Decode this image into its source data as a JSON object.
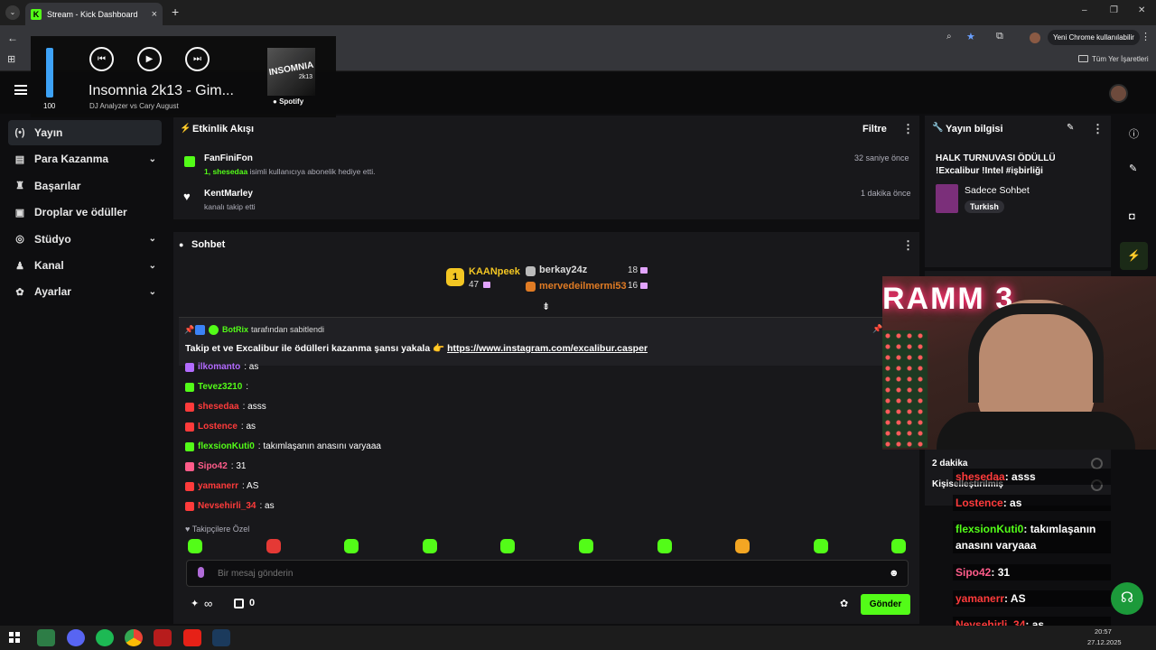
{
  "browser": {
    "tab_title": "Stream - Kick Dashboard",
    "tab_close": "×",
    "new_tab": "+",
    "profile_label": "Yeni Chrome kullanılabilir",
    "bookmarks_label": "Tüm Yer İşaretleri",
    "window_buttons": [
      "–",
      "❐",
      "✕"
    ]
  },
  "media_player": {
    "volume": "100",
    "volume_level": 1.0,
    "track_title": "Insomnia 2k13 - Gim...",
    "track_artist": "DJ Analyzer vs Cary August",
    "album_art_text": "INSOMNIA",
    "album_art_sub": "2k13",
    "service": "Spotify"
  },
  "sidebar": {
    "items": [
      {
        "label": "Yayın",
        "icon": "broadcast-icon",
        "glyph": "(•)",
        "active": true,
        "expand": false
      },
      {
        "label": "Para Kazanma",
        "icon": "money-icon",
        "glyph": "▤",
        "active": false,
        "expand": true
      },
      {
        "label": "Başarılar",
        "icon": "trophy-icon",
        "glyph": "♜",
        "active": false,
        "expand": false
      },
      {
        "label": "Droplar ve ödüller",
        "icon": "gift-icon",
        "glyph": "▣",
        "active": false,
        "expand": false
      },
      {
        "label": "Stüdyo",
        "icon": "studio-icon",
        "glyph": "◎",
        "active": false,
        "expand": true
      },
      {
        "label": "Kanal",
        "icon": "people-icon",
        "glyph": "♟",
        "active": false,
        "expand": true
      },
      {
        "label": "Ayarlar",
        "icon": "gear-icon",
        "glyph": "✿",
        "active": false,
        "expand": true
      }
    ]
  },
  "activity": {
    "title": "Etkinlik Akışı",
    "filter": "Filtre",
    "events": [
      {
        "user": "FanFiniFon",
        "detail_prefix": "1, shesedaa",
        "detail": " isimli kullanıcıya abonelik hediye etti.",
        "time": "32 saniye önce"
      },
      {
        "user": "KentMarley",
        "detail_prefix": "",
        "detail": "kanalı takip etti",
        "time": "1 dakika önce"
      }
    ]
  },
  "chat": {
    "title": "Sohbet",
    "leaderboard": [
      {
        "rank": "1",
        "name": "KAANpeek",
        "count": "47"
      },
      {
        "rank": "",
        "name": "berkay24z",
        "count": "18"
      },
      {
        "rank": "",
        "name": "mervedeilmermi53",
        "count": "16"
      }
    ],
    "pinned_by": "BotRix",
    "pinned_suffix": "tarafından sabitlendi",
    "pinned_text": "Takip et ve Excalibur ile ödülleri kazanma şansı yakala 👉 ",
    "pinned_link": "https://www.instagram.com/excalibur.casper",
    "messages": [
      {
        "user": "ilkomanto",
        "text": ": as",
        "color": "#b36bff"
      },
      {
        "user": "Tevez3210",
        "text": ":",
        "color": "#53fc18"
      },
      {
        "user": "shesedaa",
        "text": ": asss",
        "color": "#ff3b3b"
      },
      {
        "user": "Lostence",
        "text": ": as",
        "color": "#ff3b3b"
      },
      {
        "user": "flexsionKuti0",
        "text": ": takımlaşanın anasını varyaaa",
        "color": "#53fc18"
      },
      {
        "user": "Sipo42",
        "text": ": 31",
        "color": "#ff5c8a"
      },
      {
        "user": "yamanerr",
        "text": ": AS",
        "color": "#ff3b3b"
      },
      {
        "user": "Nevsehirli_34",
        "text": ": as",
        "color": "#ff3b3b"
      }
    ],
    "followers_only": "Takipçilere Özel",
    "input_placeholder": "Bir mesaj gönderin",
    "points": "∞",
    "chest_count": "0",
    "send": "Gönder"
  },
  "stream_info": {
    "title": "Yayın bilgisi",
    "stream_title": "HALK TURNUVASI ÖDÜLLÜ !Excalibur !Intel #işbirliği",
    "category": "Sadece Sohbet",
    "tag": "Turkish",
    "duration": "2 dakika",
    "customized": "Kişiselleştirilmiş"
  },
  "overlay_chat": [
    {
      "user": "shesedaa",
      "text": ": asss",
      "color": "#ff3b3b"
    },
    {
      "user": "Lostence",
      "text": ": as",
      "color": "#ff3b3b"
    },
    {
      "user": "flexsionKuti0",
      "text": ": takımlaşanın anasını varyaaa",
      "color": "#53fc18"
    },
    {
      "user": "Sipo42",
      "text": ": 31",
      "color": "#ff5c8a"
    },
    {
      "user": "yamanerr",
      "text": ": AS",
      "color": "#ff3b3b"
    },
    {
      "user": "Nevsehirli_34",
      "text": ": as",
      "color": "#ff3b3b"
    }
  ],
  "taskbar": {
    "time": "20:57",
    "date": "27.12.2025"
  },
  "colors": {
    "accent": "#53fc18",
    "panel": "#18181b",
    "bg": "#0e0e10"
  }
}
